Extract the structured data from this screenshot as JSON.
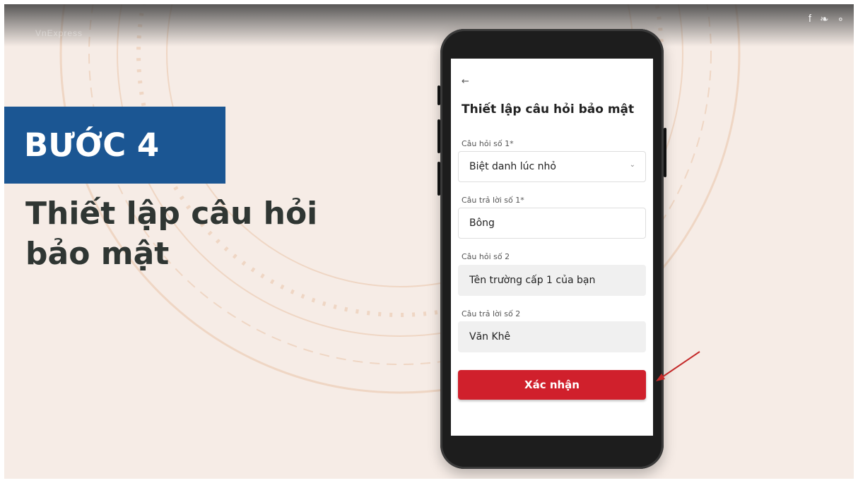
{
  "header": {
    "brand": "VnExpress",
    "share_icons": [
      "facebook-icon",
      "twitter-icon",
      "link-icon"
    ],
    "share_glyphs": {
      "facebook": "f",
      "twitter": "❧",
      "link": "∘"
    }
  },
  "step": {
    "badge": "BƯỚC 4",
    "title_line1": "Thiết lập câu hỏi",
    "title_line2": "bảo mật"
  },
  "screen": {
    "back": "←",
    "title": "Thiết lập câu hỏi bảo mật",
    "q1_label": "Câu hỏi số 1*",
    "q1_value": "Biệt danh lúc nhỏ",
    "a1_label": "Câu trả lời số 1*",
    "a1_value": "Bông",
    "q2_label": "Câu hỏi số 2",
    "q2_value": "Tên trường cấp 1 của bạn",
    "a2_label": "Câu trả lời số 2",
    "a2_value": "Văn Khê",
    "confirm_label": "Xác nhận"
  },
  "colors": {
    "badge_bg": "#1b5693",
    "confirm_bg": "#d0202c",
    "background": "#f6ece6",
    "pointer": "#c42a2a"
  }
}
